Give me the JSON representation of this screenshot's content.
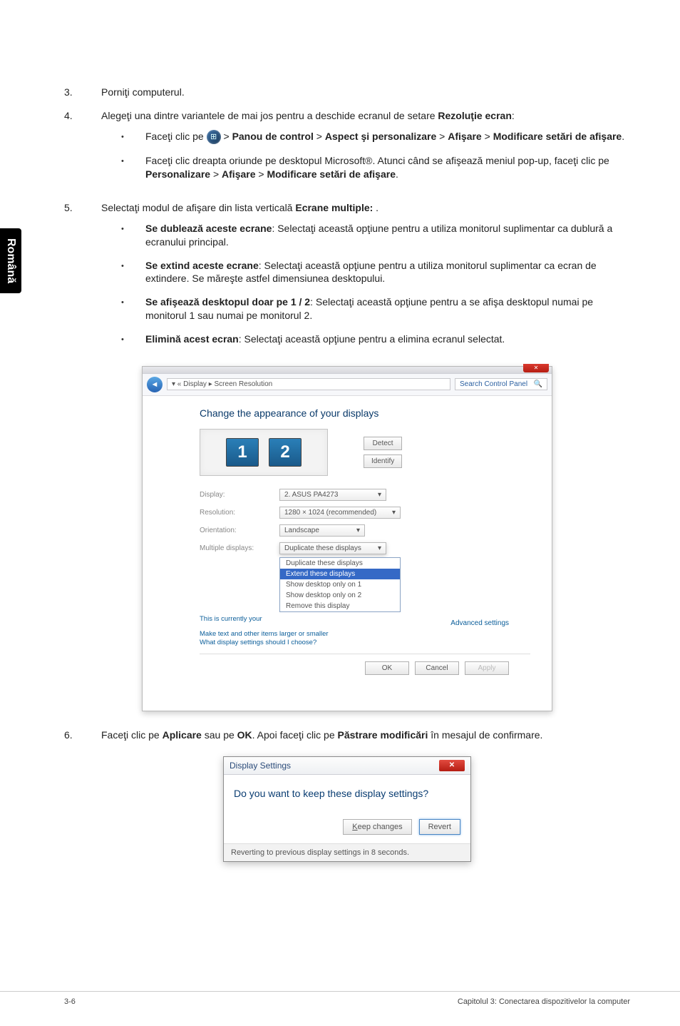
{
  "sidebar": {
    "lang": "Română"
  },
  "steps": {
    "s3": {
      "num": "3.",
      "text": "Porniţi computerul."
    },
    "s4": {
      "num": "4.",
      "intro_a": "Alegeţi una dintre variantele de mai jos pentru a deschide ecranul de setare ",
      "intro_b": "Rezoluţie ecran",
      "intro_c": ":",
      "b1_a": "Faceţi clic pe ",
      "b1_b": " > ",
      "b1_c": "Panou de control",
      "b1_d": " > ",
      "b1_e": "Aspect şi personalizare",
      "b1_f": " > ",
      "b1_g": "Afişare",
      "b1_h": " > ",
      "b1_i": "Modificare setări de afişare",
      "b1_j": ".",
      "b2_a": "Faceţi clic dreapta oriunde pe desktopul Microsoft®. Atunci când se afişează meniul pop-up, faceţi clic pe ",
      "b2_b": "Personalizare",
      "b2_c": " > ",
      "b2_d": "Afişare",
      "b2_e": " > ",
      "b2_f": "Modificare setări de afişare",
      "b2_g": "."
    },
    "s5": {
      "num": "5.",
      "intro_a": "Selectaţi modul de afişare din lista verticală ",
      "intro_b": "Ecrane multiple:",
      "intro_c": " .",
      "o1_a": "Se dublează aceste ecrane",
      "o1_b": ": Selectaţi această opţiune pentru a utiliza monitorul suplimentar ca dublură a ecranului principal.",
      "o2_a": "Se extind aceste ecrane",
      "o2_b": ": Selectaţi această opţiune pentru a utiliza monitorul suplimentar ca ecran de extindere. Se măreşte astfel dimensiunea desktopului.",
      "o3_a": "Se afişează desktopul doar pe 1 / 2",
      "o3_b": ": Selectaţi această opţiune pentru a se afişa desktopul numai pe monitorul 1 sau numai pe monitorul 2.",
      "o4_a": "Elimină acest ecran",
      "o4_b": ": Selectaţi această opţiune pentru a elimina ecranul selectat."
    },
    "s6": {
      "num": "6.",
      "a": "Faceţi clic pe ",
      "b": "Aplicare",
      "c": " sau pe ",
      "d": "OK",
      "e": ". Apoi faceţi clic pe ",
      "f": "Păstrare modificări",
      "g": " în mesajul de confirmare."
    }
  },
  "win1": {
    "breadcrumb": "▾ « Display ▸ Screen Resolution",
    "search": "Search Control Panel",
    "heading": "Change the appearance of your displays",
    "mon1": "1",
    "mon2": "2",
    "detect": "Detect",
    "identify": "Identify",
    "display_lbl": "Display:",
    "display_val": "2. ASUS PA4273",
    "resolution_lbl": "Resolution:",
    "resolution_val": "1280 × 1024 (recommended)",
    "orientation_lbl": "Orientation:",
    "orientation_val": "Landscape",
    "multi_lbl": "Multiple displays:",
    "menu_sel": "Duplicate these displays",
    "menu1": "Duplicate these displays",
    "menu2": "Extend these displays",
    "menu3": "Show desktop only on 1",
    "menu4": "Show desktop only on 2",
    "menu5": "Remove this display",
    "currently": "This is currently your",
    "advanced": "Advanced settings",
    "sub1": "Make text and other items larger or smaller",
    "sub2": "What display settings should I choose?",
    "ok": "OK",
    "cancel": "Cancel",
    "apply": "Apply"
  },
  "win2": {
    "title": "Display Settings",
    "q": "Do you want to keep these display settings?",
    "keep": "Keep changes",
    "revert": "Revert",
    "foot": "Reverting to previous display settings in 8 seconds."
  },
  "footer": {
    "page": "3-6",
    "chapter": "Capitolul 3: Conectarea dispozitivelor la computer"
  }
}
